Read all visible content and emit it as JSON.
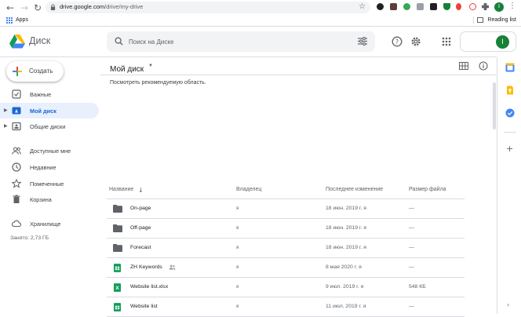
{
  "browser": {
    "url_host": "drive.google.com",
    "url_path": "/drive/my-drive",
    "bookmark_apps": "Apps",
    "reading_list": "Reading list",
    "profile_initial": "I"
  },
  "header": {
    "product": "Диск",
    "search_placeholder": "Поиск на Диске",
    "account_initial": "I"
  },
  "sidebar": {
    "create_label": "Создать",
    "items": [
      {
        "label": "Важные",
        "icon": "priority-icon"
      },
      {
        "label": "Мой диск",
        "icon": "my-drive-icon"
      },
      {
        "label": "Общие диски",
        "icon": "shared-drives-icon"
      },
      {
        "label": "Доступные мне",
        "icon": "shared-with-me-icon"
      },
      {
        "label": "Недавние",
        "icon": "recent-icon"
      },
      {
        "label": "Помеченные",
        "icon": "starred-icon"
      },
      {
        "label": "Корзина",
        "icon": "trash-icon"
      },
      {
        "label": "Хранилище",
        "icon": "cloud-icon"
      }
    ],
    "storage_used": "Занято: 2,73 ГБ"
  },
  "main": {
    "title": "Мой диск",
    "suggested_link": "Посмотреть рекомендуемую область.",
    "columns": {
      "name": "Название",
      "owner": "Владелец",
      "modified": "Последнее изменение",
      "size": "Размер файла"
    },
    "files": [
      {
        "name": "On-page",
        "type": "folder",
        "owner": "я",
        "modified": "18 июн. 2019 г. я",
        "size": "—"
      },
      {
        "name": "Off-page",
        "type": "folder",
        "owner": "я",
        "modified": "18 июн. 2019 г. я",
        "size": "—"
      },
      {
        "name": "Forecast",
        "type": "folder",
        "owner": "я",
        "modified": "18 июн. 2019 г. я",
        "size": "—"
      },
      {
        "name": "ZH Keywords",
        "type": "sheet",
        "owner": "я",
        "modified": "8 мая 2020 г. я",
        "size": "—",
        "shared": true
      },
      {
        "name": "Website list.xlsx",
        "type": "xlsx",
        "owner": "я",
        "modified": "9 июл. 2019 г. я",
        "size": "548 КБ"
      },
      {
        "name": "Website list",
        "type": "sheet",
        "owner": "я",
        "modified": "11 июл. 2019 г. я",
        "size": "—"
      }
    ]
  },
  "colors": {
    "accent": "#1967d2",
    "active_bg": "#e8f0fe",
    "sheet_green": "#0f9d58",
    "folder_gray": "#5f6368"
  }
}
